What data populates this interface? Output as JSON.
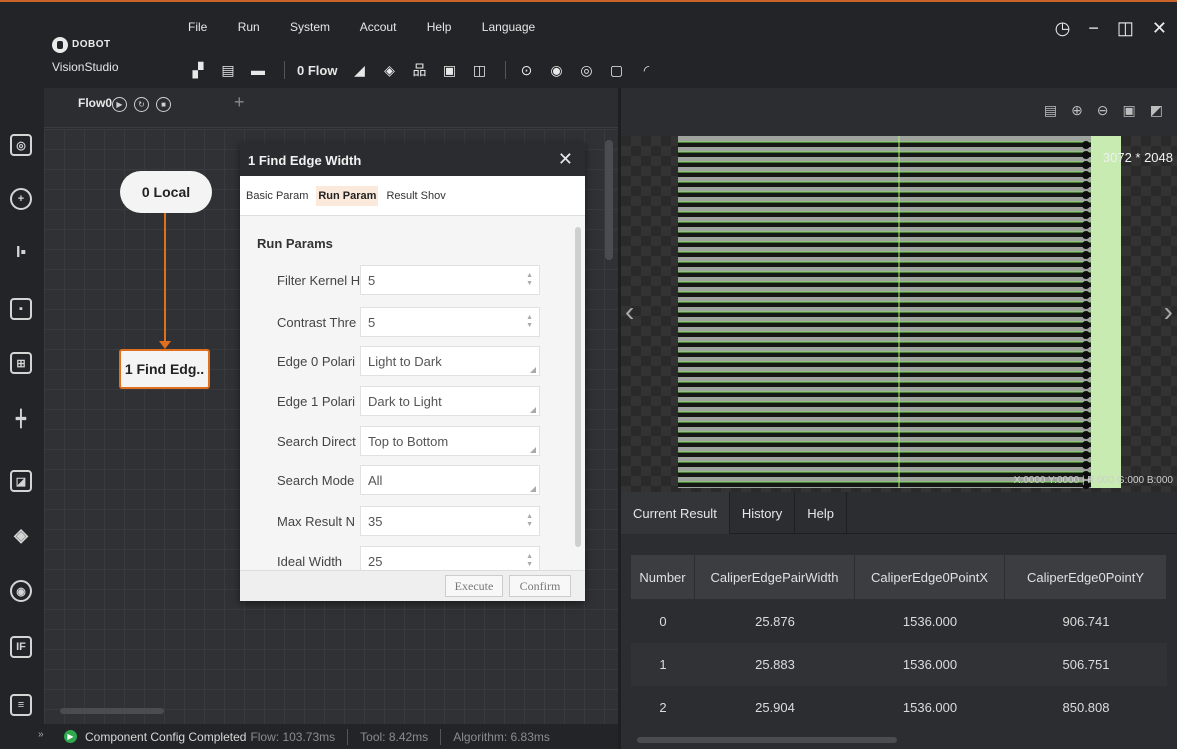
{
  "app": {
    "brand": "DOBOT",
    "product": "VisionStudio"
  },
  "menu": [
    "File",
    "Run",
    "System",
    "Accout",
    "Help",
    "Language"
  ],
  "toolbar": {
    "flow_label": "0 Flow"
  },
  "flow": {
    "tab": "Flow0",
    "nodes": [
      "0 Local",
      "1 Find Edg.."
    ]
  },
  "dialog": {
    "title": "1 Find Edge Width",
    "tabs": [
      "Basic Param",
      "Run Param",
      "Result Shov"
    ],
    "active_tab": "Run Param",
    "section": "Run Params",
    "params": [
      {
        "label": "Filter Kernel H",
        "value": "5",
        "kind": "spin"
      },
      {
        "label": "Contrast Thre",
        "value": "5",
        "kind": "spin"
      },
      {
        "label": "Edge 0 Polari",
        "value": "Light to Dark",
        "kind": "select"
      },
      {
        "label": "Edge 1 Polari",
        "value": "Dark to Light",
        "kind": "select"
      },
      {
        "label": "Search Direct",
        "value": "Top to Bottom",
        "kind": "select"
      },
      {
        "label": "Search Mode",
        "value": "All",
        "kind": "select"
      },
      {
        "label": "Max Result N",
        "value": "35",
        "kind": "spin"
      },
      {
        "label": "Ideal Width",
        "value": "25",
        "kind": "spin"
      }
    ],
    "execute": "Execute",
    "confirm": "Confirm"
  },
  "status": {
    "message": "Component Config Completed",
    "flow_time": "Flow: 103.73ms",
    "tool_time": "Tool: 8.42ms",
    "algorithm_time": "Algorithm: 6.83ms"
  },
  "image": {
    "size": "3072 * 2048",
    "pixel_info": "X:0000 Y:0000 | R:000 G:000 B:000"
  },
  "results": {
    "tabs": [
      "Current Result",
      "History",
      "Help"
    ],
    "active_tab": "Current Result",
    "columns": [
      "Number",
      "CaliperEdgePairWidth",
      "CaliperEdge0PointX",
      "CaliperEdge0PointY"
    ],
    "rows": [
      [
        "0",
        "25.876",
        "1536.000",
        "906.741"
      ],
      [
        "1",
        "25.883",
        "1536.000",
        "506.751"
      ],
      [
        "2",
        "25.904",
        "1536.000",
        "850.808"
      ]
    ]
  },
  "colors": {
    "accent": "#e07020",
    "edge_overlay": "#7fe05a",
    "run_ok": "#2fa84f"
  }
}
